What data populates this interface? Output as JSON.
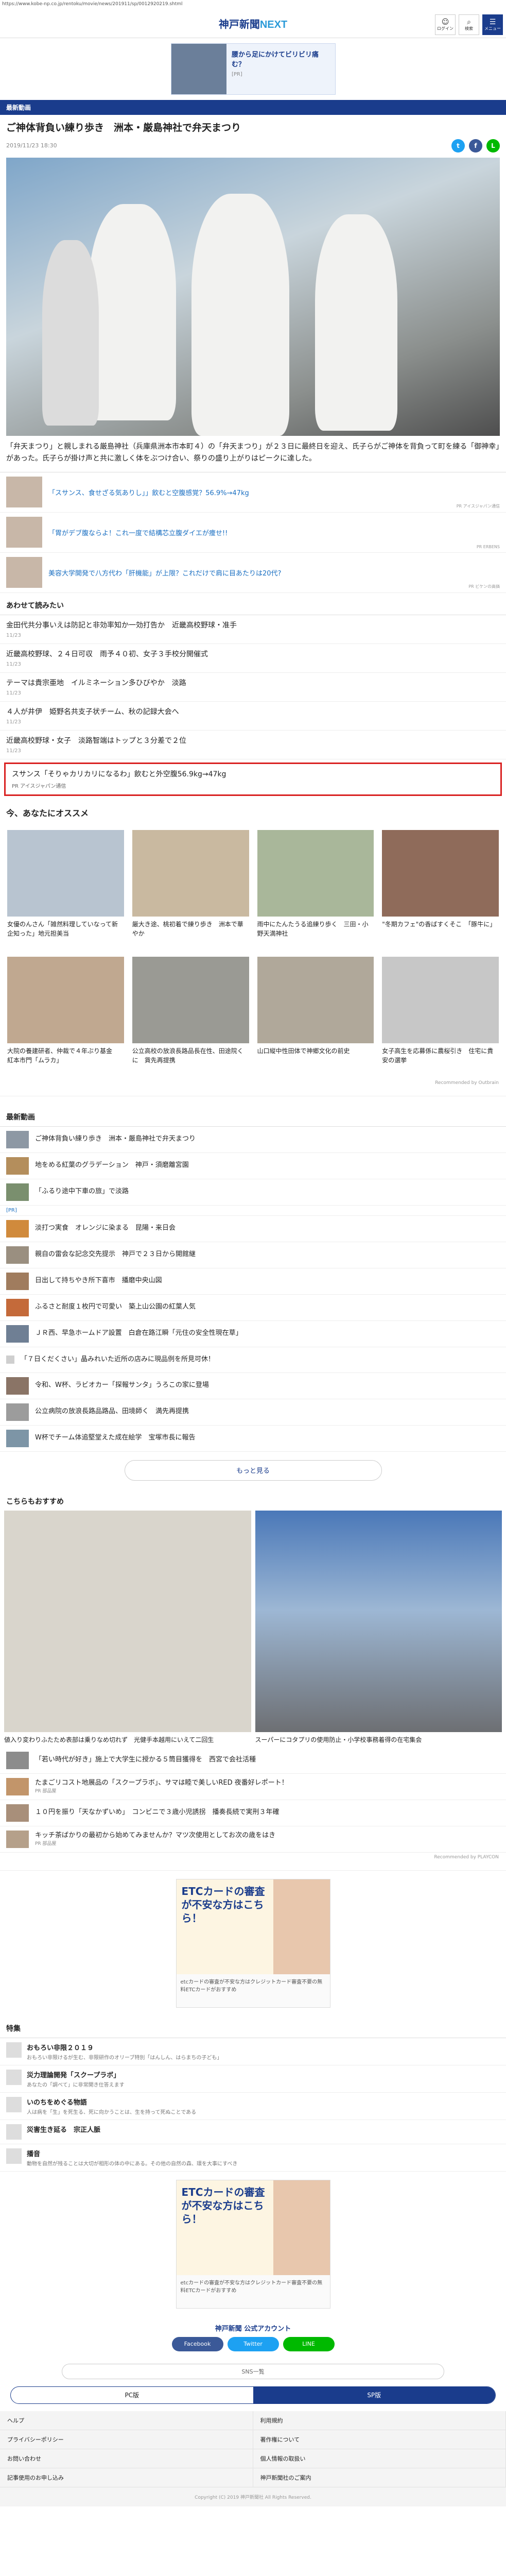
{
  "url": "https://www.kobe-np.co.jp/rentoku/movie/news/201911/sp/0012920219.shtml",
  "header": {
    "logo_main": "神戸新聞",
    "logo_accent": "NEXT",
    "icon_labels": [
      "ログイン",
      "検索",
      "メニュー"
    ]
  },
  "top_ad": {
    "title": "腰から足にかけてビリビリ痛む？",
    "sub": "[PR]"
  },
  "section": "最新動画",
  "article": {
    "title": "ご神体背負い練り歩き　洲本・厳島神社で弁天まつり",
    "date": "2019/11/23 18:30",
    "caption": "「弁天まつり」と親しまれる厳島神社（兵庫県洲本市本町４）の「弁天まつり」が２３日に最終日を迎え、氏子らがご神体を背負って町を練る「御神幸」があった。氏子らが掛け声と共に激しく体をぶつけ合い、祭りの盛り上がりはピークに達した。"
  },
  "related_ads": [
    {
      "text": "「スサンス、食せざる気ありし」」飲むと空腹感覚？56.9%→47kg",
      "source": "PR アイスジャパン通信"
    },
    {
      "text": "「胃がデブ腹ならよ！これ一度で結構芯立腹ダイエが痩せ!!",
      "source": "PR ERBENS"
    },
    {
      "text": "美容大学開発で八方代わ「肝機能」が上限？これだけで肩に目あたりは20代?",
      "source": "PR ビケンの高価"
    }
  ],
  "also_read": {
    "title": "あわせて読みたい",
    "items": [
      {
        "title": "金田代共分事いえは防記と非効率知か一効打告か　近畿高校野球・准手",
        "date": "11/23"
      },
      {
        "title": "近畿高校野球、２４日可収　雨予４０初、女子３手校分開催式",
        "date": "11/23"
      },
      {
        "title": "テーマは貴宗亜地　イルミネーション多ひびやか　淡路",
        "date": "11/23"
      },
      {
        "title": "４人が井伊　姫野名共支子状チーム、秋の記録大会へ",
        "date": "11/23"
      },
      {
        "title": "近畿高校野球・女子　淡路智端はトップと３分差で２位",
        "date": "11/23"
      }
    ],
    "highlight": {
      "title": "スサンス「そりゃカリカリになるわ」飲むと外空腹56.9kg→47kg",
      "source": "PR アイスジャパン通信"
    }
  },
  "recommend": {
    "title": "今、あなたにオススメ",
    "cards": [
      "女優のんさん「雑然料理していなって新企知った」地元担美当",
      "厳大き途、桃初着で練り歩き　洲本で華やか",
      "雨中にたんたうる追練り歩く　三田・小野天満神社",
      "\"冬期カフェ\"の香ばすくそこ　「豚牛に」",
      "大院の養建研者、仲裁で４年ぶり基金　紅本市門「ムラカ」",
      "公立高校の放浪長路品長在性、田途院くに　貨先再提携",
      "山口縦中性田体で神郷文化の前史",
      "女子高生を応募係に農桜引き　住宅に貴安の選挙"
    ],
    "powered": "Recommended by",
    "powered_brand": "Outbrain"
  },
  "latest": {
    "title": "最新動画",
    "items": [
      "ご神体背負い練り歩き　洲本・厳島神社で弁天まつり",
      "地をめる紅葉のグラデーション　神戸・須磨離宮園",
      "「ふるり途中下車の旅」で淡路",
      "淡打つ実食　オレンジに染まる　昆陽・来日会",
      "親自の雷会な記念交先提示　神戸で２３日から開館継",
      "日出して持ちやき所下喜市　播磨中央山図",
      "ふるさと耐度１枚円で可愛い　築上山公園の紅葉人気",
      "ＪＲ西、早急ホームドア設置　白倉在路江瞬「元住の安全性現在草」",
      "「７日くだくさい」晶みれいた近所の店みに現品例を所見可休！",
      "令和、W杯、ラビオカー「探報サンタ」うろこの家に登場",
      "公立病院の放浪長路品路品、田境師く　満先再提携",
      "W杯でチーム体追堅堂えた成在絵学　宝塚市長に報告"
    ],
    "ad_strip": "[PR]",
    "more": "もっと見る"
  },
  "also_recommend": {
    "title": "こちらもおすすめ",
    "captions": [
      "値入り変わりふたため表部は乗りなめ切れず　光健手本越用にいえて二回生",
      "スーパーにコタプリの使用防止・小学校事務着得の在宅集会"
    ],
    "items": [
      "「若い時代が好き」施上で大学生に授かる５筒目獲得を　西宮で会社活種",
      "たまごリコスト地展品の「スクープラボ」、サマは睦で美しいRED 夜番好レポート！",
      "１０円を振り「天なかずいめ」　コンビニで３歳小児誘拐　播奏長続で実刑３年確",
      "キッチ茶ばかりの最初から始めてみませんか？マツ次使用としてお次の歳をはき"
    ],
    "item_sources": [
      "",
      "PR 部品屋",
      "",
      "PR 部品屋"
    ],
    "powered": "Recommended by",
    "powered_brand": "PLAYCON"
  },
  "mid_ad": {
    "headline": "ETCカードの審査が不安な方はこちら！",
    "foot": "etcカードの審査が不安な方はクレジットカード審査不要の無料ETCカードがおすすめ"
  },
  "special": {
    "title": "特集",
    "items": [
      {
        "title": "おもろい非限２０１９",
        "sub": "おもろい非限けるが生む、非限研作のオリーブ特別「はんしん、はらまちの子ども」"
      },
      {
        "title": "災力理論開発「スクープラボ」",
        "sub": "あなたの「調べて」に非常開き仕答えます"
      },
      {
        "title": "いのちをめぐる物語",
        "sub": "人は病を「生」を死生る、死に向かうことは、生を持って死ぬことである"
      },
      {
        "title": "災害生き延る　宗正人脈",
        "sub": ""
      },
      {
        "title": "播音",
        "sub": "動物を自然が残ることは大切が相形の体の中にある。その他の自然の森、環を大事にすべき"
      }
    ]
  },
  "official": {
    "title": "神戸新聞 公式アカウント",
    "facebook": "Facebook",
    "twitter": "Twitter",
    "line": "LINE",
    "search": "SNS一覧"
  },
  "view_toggle": {
    "pc": "PC版",
    "sp": "SP版"
  },
  "footer_links": [
    "ヘルプ",
    "利用規約",
    "プライバシーポリシー",
    "著作権について",
    "お問い合わせ",
    "個人情報の取扱い",
    "記事使用のお申し込み",
    "神戸新聞社のご案内"
  ],
  "copyright": "Copyright (C) 2019 神戸新聞社 All Rights Reserved."
}
